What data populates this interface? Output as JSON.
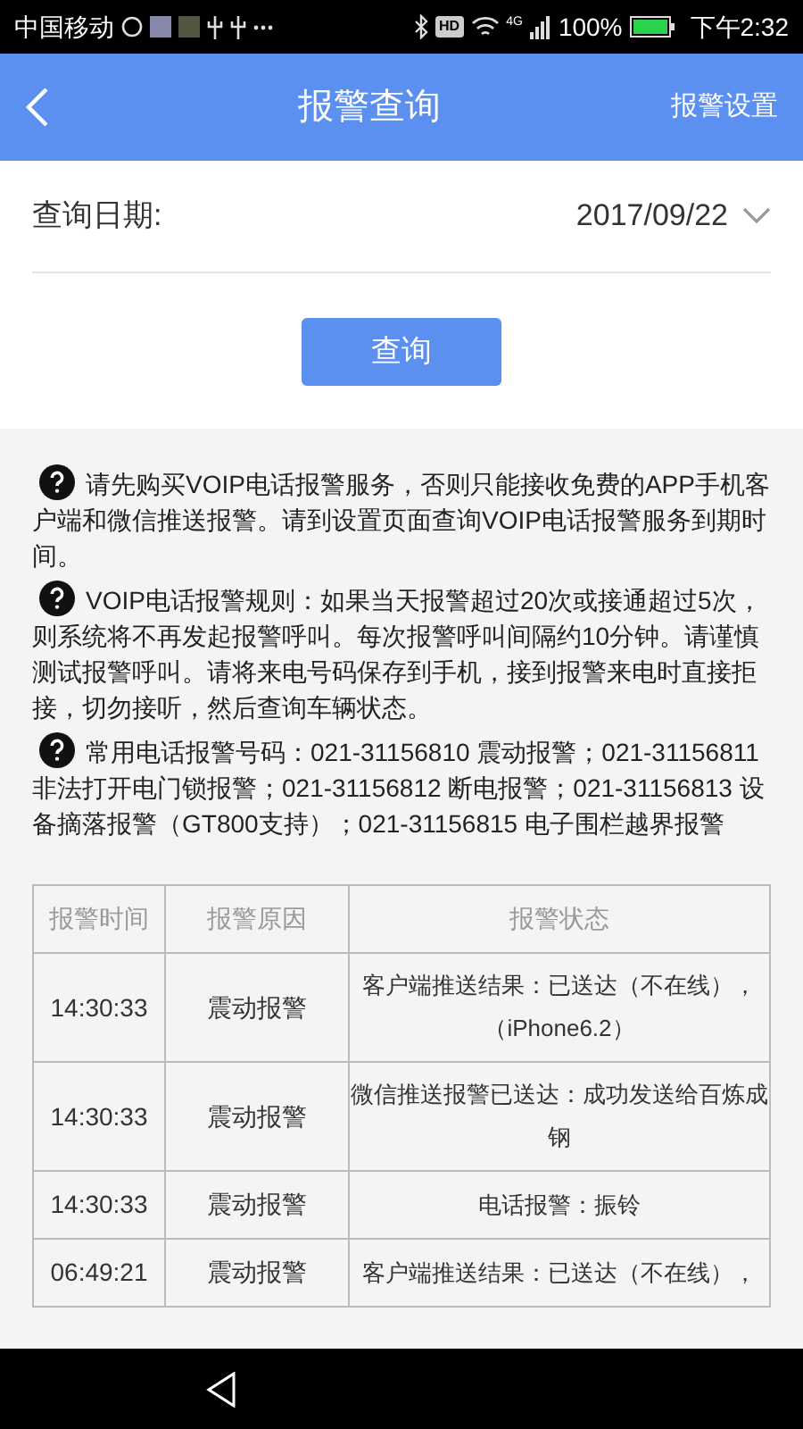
{
  "status_bar": {
    "carrier": "中国移动",
    "network_badge": "HD",
    "network_type": "4G",
    "battery": "100%",
    "time": "下午2:32"
  },
  "header": {
    "title": "报警查询",
    "action": "报警设置"
  },
  "query": {
    "label": "查询日期:",
    "date": "2017/09/22",
    "button": "查询"
  },
  "notes": [
    "请先购买VOIP电话报警服务，否则只能接收免费的APP手机客户端和微信推送报警。请到设置页面查询VOIP电话报警服务到期时间。",
    "VOIP电话报警规则：如果当天报警超过20次或接通超过5次，则系统将不再发起报警呼叫。每次报警呼叫间隔约10分钟。请谨慎测试报警呼叫。请将来电号码保存到手机，接到报警来电时直接拒接，切勿接听，然后查询车辆状态。",
    "常用电话报警号码：021-31156810 震动报警；021-31156811 非法打开电门锁报警；021-31156812 断电报警；021-31156813 设备摘落报警（GT800支持）；021-31156815 电子围栏越界报警"
  ],
  "table": {
    "columns": [
      "报警时间",
      "报警原因",
      "报警状态"
    ],
    "rows": [
      {
        "time": "14:30:33",
        "reason": "震动报警",
        "status": "客户端推送结果：已送达（不在线），（iPhone6.2）"
      },
      {
        "time": "14:30:33",
        "reason": "震动报警",
        "status": "微信推送报警已送达：成功发送给百炼成钢"
      },
      {
        "time": "14:30:33",
        "reason": "震动报警",
        "status": "电话报警：振铃"
      },
      {
        "time": "06:49:21",
        "reason": "震动报警",
        "status": "客户端推送结果：已送达（不在线），"
      }
    ]
  }
}
